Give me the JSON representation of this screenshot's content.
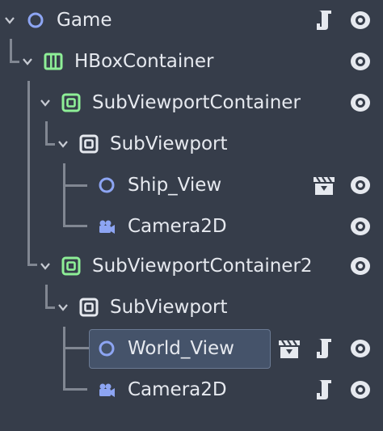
{
  "scene_tree": {
    "nodes": [
      {
        "label": "Game",
        "type_icon": "node2d-circle-icon",
        "expanded": true,
        "script": true,
        "clapper": false,
        "selected": false
      },
      {
        "label": "HBoxContainer",
        "type_icon": "hbox-container-icon",
        "expanded": true,
        "script": false,
        "clapper": false,
        "selected": false
      },
      {
        "label": "SubViewportContainer",
        "type_icon": "subviewport-container-icon",
        "expanded": true,
        "script": false,
        "clapper": false,
        "selected": false
      },
      {
        "label": "SubViewport",
        "type_icon": "subviewport-icon",
        "expanded": true,
        "script": false,
        "clapper": false,
        "selected": false
      },
      {
        "label": "Ship_View",
        "type_icon": "node2d-circle-icon",
        "expanded": false,
        "script": false,
        "clapper": true,
        "selected": false
      },
      {
        "label": "Camera2D",
        "type_icon": "camera2d-icon",
        "expanded": false,
        "script": false,
        "clapper": false,
        "selected": false
      },
      {
        "label": "SubViewportContainer2",
        "type_icon": "subviewport-container-icon",
        "expanded": true,
        "script": false,
        "clapper": false,
        "selected": false
      },
      {
        "label": "SubViewport",
        "type_icon": "subviewport-icon",
        "expanded": true,
        "script": false,
        "clapper": false,
        "selected": false
      },
      {
        "label": "World_View",
        "type_icon": "node2d-circle-icon",
        "expanded": false,
        "script": true,
        "clapper": true,
        "selected": true
      },
      {
        "label": "Camera2D",
        "type_icon": "camera2d-icon",
        "expanded": false,
        "script": true,
        "clapper": false,
        "selected": false
      }
    ]
  },
  "colors": {
    "background": "#363d4a",
    "node2d": "#8da5f3",
    "control": "#8eef97",
    "text": "#e6e9ef",
    "selection": "#45536a"
  }
}
